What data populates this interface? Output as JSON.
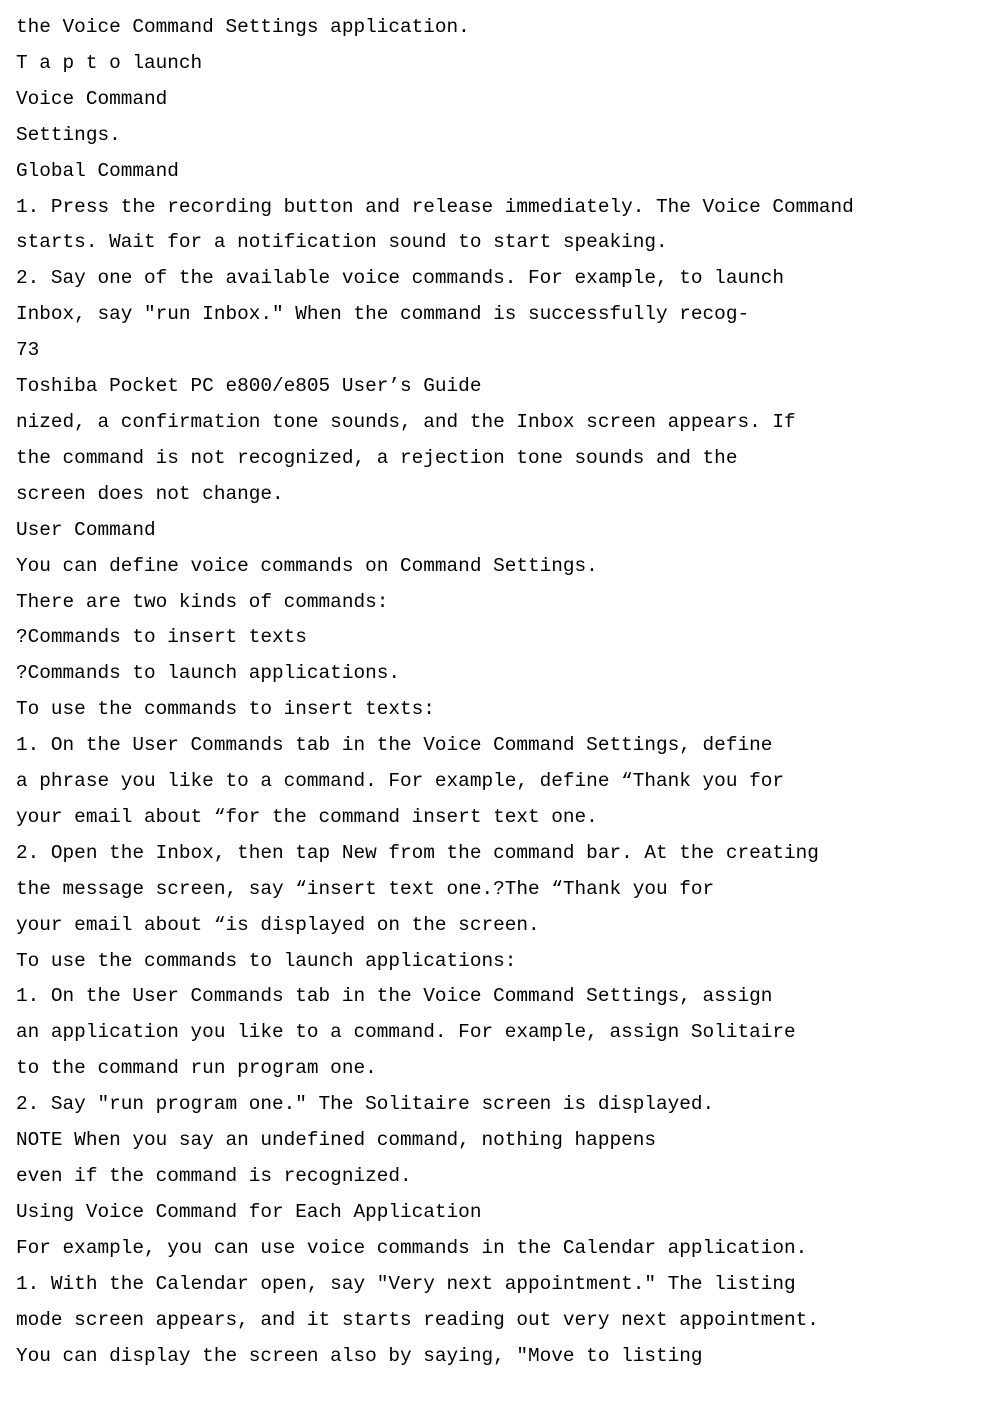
{
  "lines": [
    "the Voice Command Settings application.",
    "T a p t o launch",
    "Voice Command",
    "Settings.",
    "Global Command",
    "1. Press the recording button and release immediately. The Voice Command",
    "starts. Wait for a notification sound to start speaking.",
    "2. Say one of the available voice commands. For example, to launch",
    "Inbox, say \"run Inbox.\" When the command is successfully recog-",
    "73",
    "Toshiba Pocket PC e800/e805 User’s Guide",
    "nized, a confirmation tone sounds, and the Inbox screen appears. If",
    "the command is not recognized, a rejection tone sounds and the",
    "screen does not change.",
    "User Command",
    "You can define voice commands on Command Settings.",
    "There are two kinds of commands:",
    "?Commands to insert texts",
    "?Commands to launch applications.",
    "To use the commands to insert texts:",
    "1. On the User Commands tab in the Voice Command Settings, define",
    "a phrase you like to a command. For example, define “Thank you for",
    "your email about “for the command insert text one.",
    "2. Open the Inbox, then tap New from the command bar. At the creating",
    "the message screen, say “insert text one.?The “Thank you for",
    "your email about “is displayed on the screen.",
    "To use the commands to launch applications:",
    "1. On the User Commands tab in the Voice Command Settings, assign",
    "an application you like to a command. For example, assign Solitaire",
    "to the command run program one.",
    "2. Say \"run program one.\" The Solitaire screen is displayed.",
    "NOTE When you say an undefined command, nothing happens",
    "even if the command is recognized.",
    "Using Voice Command for Each Application",
    "For example, you can use voice commands in the Calendar application.",
    "1. With the Calendar open, say \"Very next appointment.\" The listing",
    "mode screen appears, and it starts reading out very next appointment.",
    "You can display the screen also by saying, \"Move to listing"
  ]
}
